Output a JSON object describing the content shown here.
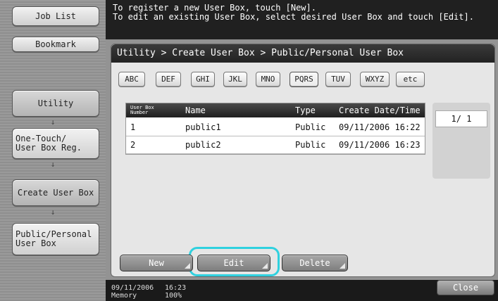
{
  "left_nav": {
    "job_list": "Job List",
    "bookmark": "Bookmark",
    "items": [
      "Utility",
      "One-Touch/\nUser Box Reg.",
      "Create User Box",
      "Public/Personal\nUser Box"
    ],
    "arrow": "↓"
  },
  "message": {
    "line1": "To register a new User Box, touch [New].",
    "line2": "To edit an existing User Box, select desired User Box and touch [Edit]."
  },
  "breadcrumb": "Utility > Create User Box > Public/Personal User Box",
  "index_tabs": [
    "ABC",
    "DEF",
    "GHI",
    "JKL",
    "MNO",
    "PQRS",
    "TUV",
    "WXYZ",
    "etc"
  ],
  "active_tab": "PQRS",
  "table": {
    "headers": {
      "number": "User Box\nNumber",
      "name": "Name",
      "type": "Type",
      "date": "Create Date/Time"
    },
    "rows": [
      {
        "number": "1",
        "name": "public1",
        "type": "Public",
        "date": "09/11/2006 16:22"
      },
      {
        "number": "2",
        "name": "public2",
        "type": "Public",
        "date": "09/11/2006 16:23"
      }
    ]
  },
  "pager": "1/  1",
  "buttons": {
    "new": "New",
    "edit": "Edit",
    "delete": "Delete",
    "close": "Close"
  },
  "status": {
    "date": "09/11/2006",
    "time": "16:23",
    "memory_label": "Memory",
    "memory_value": "100%"
  },
  "colors": {
    "highlight": "#2fd1df"
  }
}
